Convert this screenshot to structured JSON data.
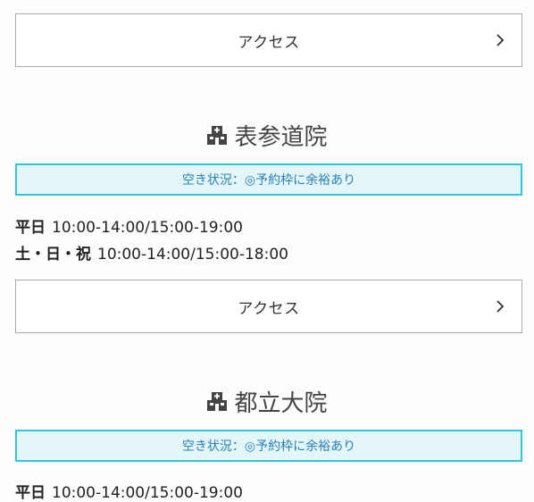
{
  "access_label": "アクセス",
  "clinics": [
    {
      "name": "表参道院",
      "status": "空き状況：◎予約枠に余裕あり",
      "hours": [
        {
          "day": "平日",
          "time": "10:00-14:00/15:00-19:00"
        },
        {
          "day": "土・日・祝",
          "time": "10:00-14:00/15:00-18:00"
        }
      ]
    },
    {
      "name": "都立大院",
      "status": "空き状況：◎予約枠に余裕あり",
      "hours": [
        {
          "day": "平日",
          "time": "10:00-14:00/15:00-19:00"
        }
      ]
    }
  ],
  "icons": {
    "chevron": "chevron-right-icon",
    "hospital": "hospital-icon"
  },
  "colors": {
    "status_border": "#2ec5e0",
    "status_bg": "#e3f7f9",
    "status_text": "#2a7fb5"
  }
}
